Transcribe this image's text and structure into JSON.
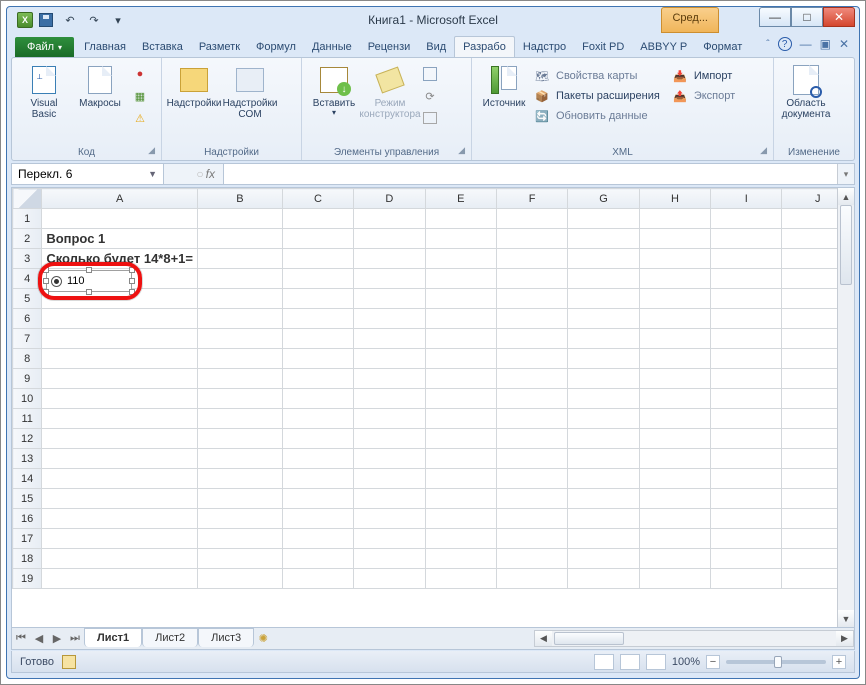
{
  "window": {
    "title": "Книга1 - Microsoft Excel",
    "context_tab": "Сред..."
  },
  "qat": {
    "undo": "↶",
    "redo": "↷",
    "dd": "▾"
  },
  "tabs": {
    "file": "Файл",
    "items": [
      "Главная",
      "Вставка",
      "Разметк",
      "Формул",
      "Данные",
      "Рецензи",
      "Вид",
      "Разрабо",
      "Надстро",
      "Foxit PD",
      "ABBYY P",
      "Формат"
    ],
    "active_index": 7
  },
  "ribbon": {
    "code": {
      "visual_basic": "Visual Basic",
      "macros": "Макросы",
      "label": "Код"
    },
    "addins": {
      "addins": "Надстройки",
      "com": "Надстройки COM",
      "label": "Надстройки"
    },
    "controls": {
      "insert": "Вставить",
      "design": "Режим конструктора",
      "label": "Элементы управления"
    },
    "xml": {
      "source": "Источник",
      "map_props": "Свойства карты",
      "expansion": "Пакеты расширения",
      "refresh": "Обновить данные",
      "import": "Импорт",
      "export": "Экспорт",
      "label": "XML"
    },
    "docpanel": {
      "btn": "Область документа",
      "label": "Изменение"
    }
  },
  "namebox": "Перекл. 6",
  "fx": "fx",
  "columns": [
    "A",
    "B",
    "C",
    "D",
    "E",
    "F",
    "G",
    "H",
    "I",
    "J"
  ],
  "cells": {
    "a2": "Вопрос 1",
    "a3": "Сколько будет 14*8+1="
  },
  "control": {
    "label": "110"
  },
  "sheets": {
    "nav": [
      "⏮",
      "◀",
      "▶",
      "⏭"
    ],
    "items": [
      "Лист1",
      "Лист2",
      "Лист3"
    ],
    "active_index": 0,
    "new": "⊕"
  },
  "status": {
    "ready": "Готово",
    "zoom": "100%",
    "minus": "−",
    "plus": "+"
  },
  "winbtns": {
    "min": "—",
    "max": "□",
    "close": "✕"
  },
  "help": {
    "caret": "�△",
    "q": "?",
    "m": "—",
    "r": "▣",
    "x": "✕"
  }
}
